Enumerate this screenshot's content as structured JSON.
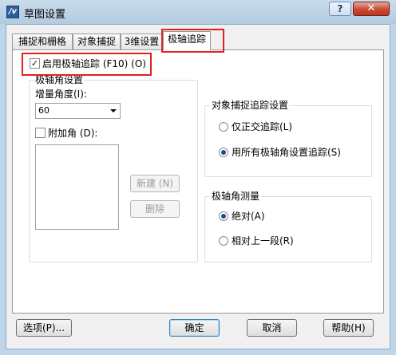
{
  "window": {
    "title": "草图设置",
    "app_icon_glyph": "/v",
    "help_glyph": "?",
    "close_glyph": "✕"
  },
  "tabs": [
    {
      "label": "捕捉和栅格"
    },
    {
      "label": "对象捕捉"
    },
    {
      "label": "3维设置"
    },
    {
      "label": "极轴追踪",
      "active": true
    }
  ],
  "enable_polar": {
    "label": "启用极轴追踪 (F10) (O)",
    "checked": true,
    "check_glyph": "✓"
  },
  "polar_angle": {
    "group_title": "极轴角设置",
    "increment_label": "增量角度(I):",
    "increment_value": "60",
    "additional_label": "附加角 (D):",
    "additional_checked": false,
    "new_button": "新建 (N)",
    "delete_button": "删除"
  },
  "snap_tracking": {
    "group_title": "对象捕捉追踪设置",
    "options": [
      {
        "label": "仅正交追踪(L)",
        "selected": false
      },
      {
        "label": "用所有极轴角设置追踪(S)",
        "selected": true
      }
    ]
  },
  "measure": {
    "group_title": "极轴角测量",
    "options": [
      {
        "label": "绝对(A)",
        "selected": true
      },
      {
        "label": "相对上一段(R)",
        "selected": false
      }
    ]
  },
  "footer": {
    "options": "选项(P)...",
    "ok": "确定",
    "cancel": "取消",
    "help": "帮助(H)"
  },
  "colors": {
    "highlight_box": "#e22020",
    "titlebar": "#bfd6ea",
    "close_button": "#c94a35"
  }
}
